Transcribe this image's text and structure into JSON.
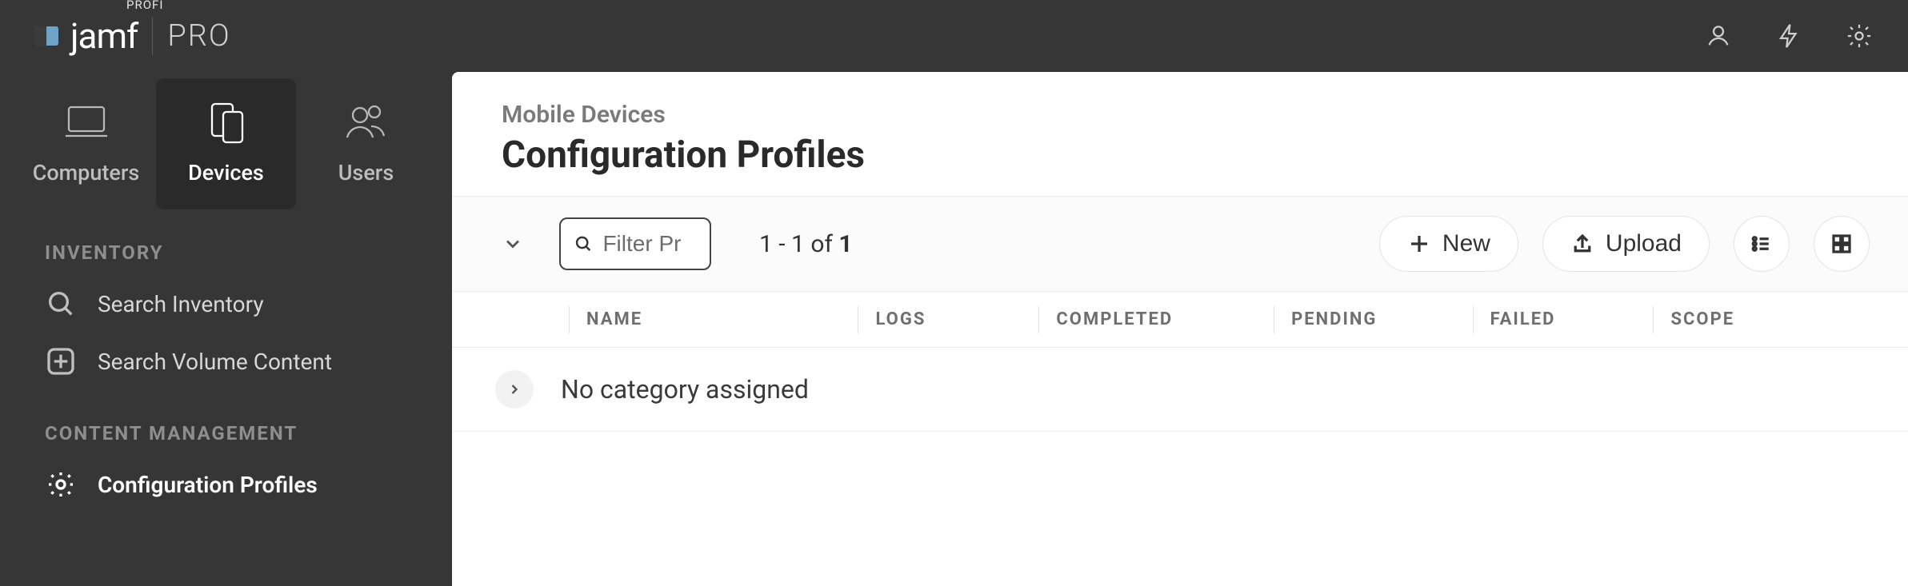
{
  "brand": {
    "profi": "PROFI",
    "jamf": "jamf",
    "pro": "PRO"
  },
  "modules": {
    "computers": "Computers",
    "devices": "Devices",
    "users": "Users"
  },
  "sidebar": {
    "sections": {
      "inventory_title": "INVENTORY",
      "content_mgmt_title": "CONTENT MANAGEMENT"
    },
    "items": {
      "search_inventory": "Search Inventory",
      "search_volume": "Search Volume Content",
      "config_profiles": "Configuration Profiles"
    }
  },
  "main": {
    "breadcrumb": "Mobile Devices",
    "title": "Configuration Profiles",
    "filter_placeholder": "Filter Pr",
    "count_prefix": "1 - 1 of ",
    "count_total": "1",
    "buttons": {
      "new": "New",
      "upload": "Upload"
    },
    "columns": {
      "name": "NAME",
      "logs": "LOGS",
      "completed": "COMPLETED",
      "pending": "PENDING",
      "failed": "FAILED",
      "scope": "SCOPE"
    },
    "group_row": "No category assigned"
  }
}
